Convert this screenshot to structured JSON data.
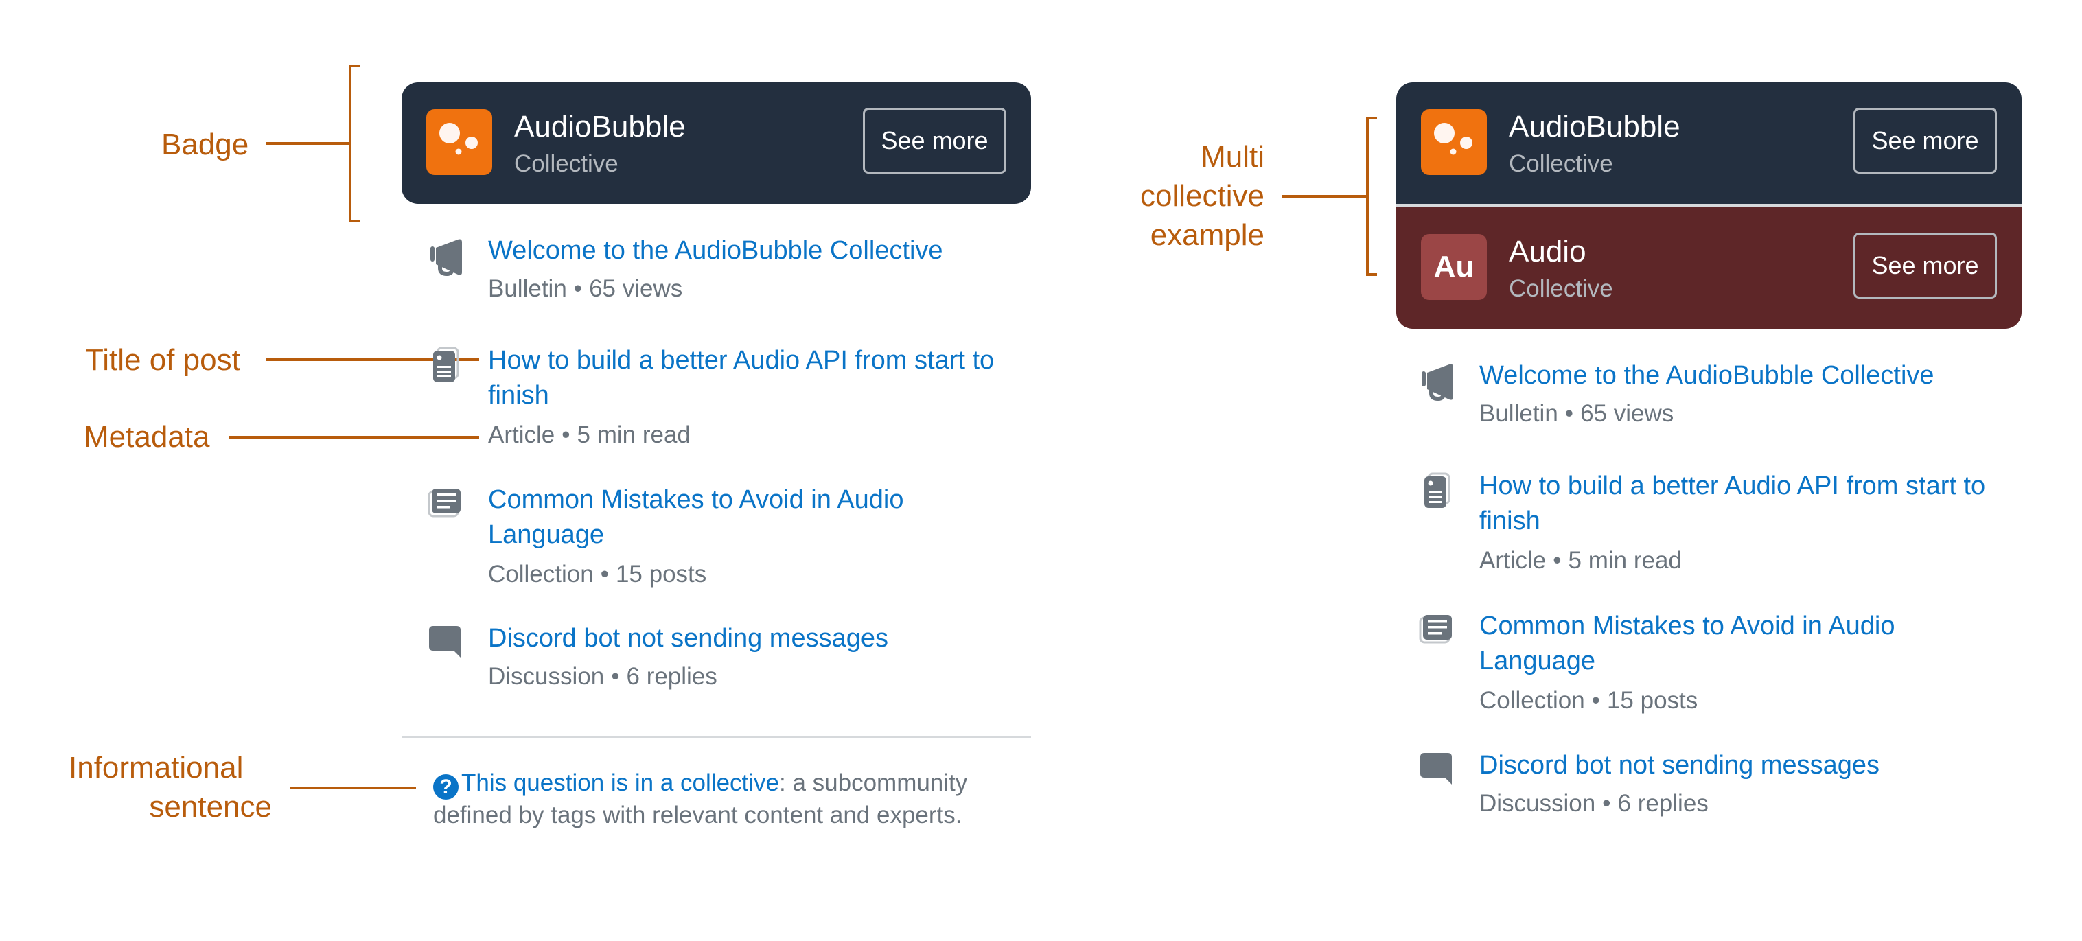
{
  "annotations": {
    "badge": "Badge",
    "title_of_post": "Title of post",
    "metadata": "Metadata",
    "informational_line1": "Informational",
    "informational_line2": "sentence",
    "multi_line1": "Multi",
    "multi_line2": "collective",
    "multi_line3": "example"
  },
  "colors": {
    "annotation": "#b85c0c",
    "card_dark": "#232f3f",
    "card_red": "#5e2628",
    "logo_orange": "#f0720f",
    "logo_rose": "#9b4646",
    "link_blue": "#0a74c7",
    "meta_gray": "#6a737c",
    "icon_gray": "#6a737c"
  },
  "left_example": {
    "collectives": [
      {
        "name": "AudioBubble",
        "subtitle": "Collective",
        "button": "See more",
        "logo": "bubbles-logo-icon"
      }
    ],
    "posts": [
      {
        "icon": "megaphone-icon",
        "title": "Welcome to the AudioBubble Collective",
        "type": "Bulletin",
        "stat": "65 views"
      },
      {
        "icon": "article-icon",
        "title": "How to build a better Audio API from start to finish",
        "type": "Article",
        "stat": "5 min read"
      },
      {
        "icon": "collection-icon",
        "title": "Common Mistakes to Avoid in Audio Language",
        "type": "Collection",
        "stat": "15 posts"
      },
      {
        "icon": "discussion-icon",
        "title": "Discord bot not sending messages",
        "type": "Discussion",
        "stat": "6 replies"
      }
    ],
    "info": {
      "icon": "question-circle-icon",
      "link_text": "This question is in a collective",
      "rest_text": ": a subcommunity defined by tags with relevant content and experts."
    }
  },
  "right_example": {
    "collectives": [
      {
        "name": "AudioBubble",
        "subtitle": "Collective",
        "button": "See more",
        "logo": "bubbles-logo-icon"
      },
      {
        "name": "Audio",
        "subtitle": "Collective",
        "button": "See more",
        "logo_text": "Au"
      }
    ],
    "posts": [
      {
        "icon": "megaphone-icon",
        "title": "Welcome to the AudioBubble Collective",
        "type": "Bulletin",
        "stat": "65 views"
      },
      {
        "icon": "article-icon",
        "title": "How to build a better Audio API from start to finish",
        "type": "Article",
        "stat": "5 min read"
      },
      {
        "icon": "collection-icon",
        "title": "Common Mistakes to Avoid in Audio Language",
        "type": "Collection",
        "stat": "15 posts"
      },
      {
        "icon": "discussion-icon",
        "title": "Discord bot not sending messages",
        "type": "Discussion",
        "stat": "6 replies"
      }
    ]
  },
  "separator": "•"
}
